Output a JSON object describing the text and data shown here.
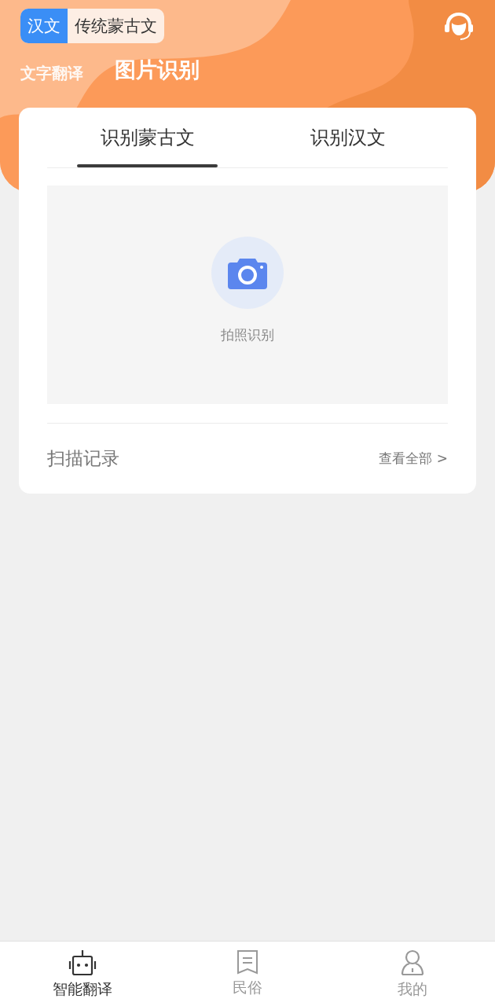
{
  "language_switch": [
    {
      "label": "汉文",
      "selected": true
    },
    {
      "label": "传统蒙古文",
      "selected": false
    }
  ],
  "mode_tabs": [
    {
      "label": "文字翻译",
      "selected": false
    },
    {
      "label": "图片识别",
      "selected": true
    }
  ],
  "card": {
    "tabs": [
      {
        "label": "识别蒙古文",
        "selected": true
      },
      {
        "label": "识别汉文",
        "selected": false
      }
    ],
    "capture": {
      "label": "拍照识别"
    },
    "history": {
      "title": "扫描记录",
      "link": "查看全部 >"
    }
  },
  "bottom_nav": [
    {
      "kind": "robot",
      "label": "智能翻译",
      "selected": true
    },
    {
      "kind": "book",
      "label": "民俗",
      "selected": false
    },
    {
      "kind": "person",
      "label": "我的",
      "selected": false
    }
  ]
}
